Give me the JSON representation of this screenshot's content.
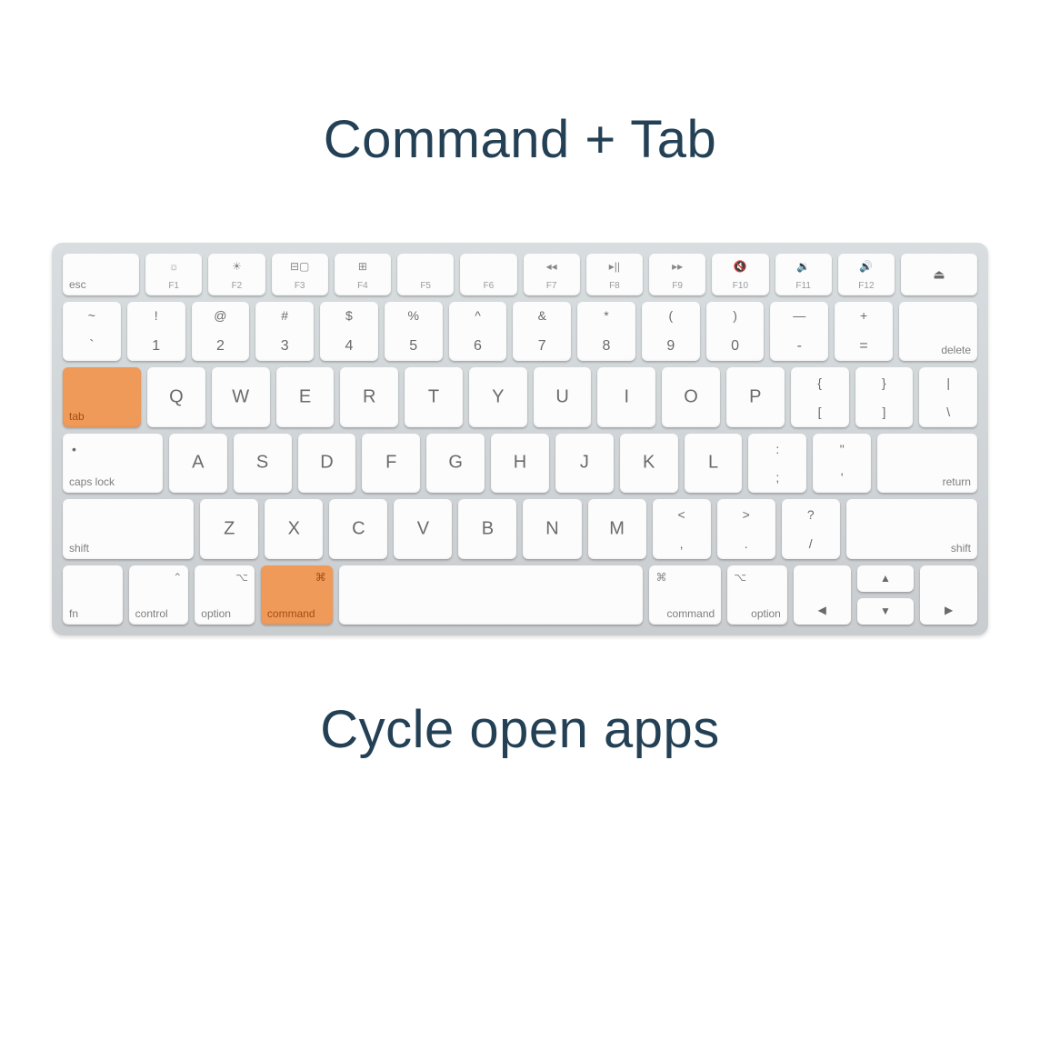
{
  "title": "Command + Tab",
  "subtitle": "Cycle open apps",
  "colors": {
    "highlight": "#f09a5a",
    "text": "#234055"
  },
  "rows": {
    "fn": {
      "esc": "esc",
      "keys": [
        {
          "icon": "☼",
          "label": "F1"
        },
        {
          "icon": "☀",
          "label": "F2"
        },
        {
          "icon": "⊟▢",
          "label": "F3"
        },
        {
          "icon": "⊞",
          "label": "F4"
        },
        {
          "icon": "",
          "label": "F5"
        },
        {
          "icon": "",
          "label": "F6"
        },
        {
          "icon": "◂◂",
          "label": "F7"
        },
        {
          "icon": "▸||",
          "label": "F8"
        },
        {
          "icon": "▸▸",
          "label": "F9"
        },
        {
          "icon": "🔇",
          "label": "F10"
        },
        {
          "icon": "🔉",
          "label": "F11"
        },
        {
          "icon": "🔊",
          "label": "F12"
        }
      ],
      "eject": "⏏"
    },
    "num": {
      "tilde": {
        "top": "~",
        "bot": "`"
      },
      "keys": [
        {
          "top": "!",
          "bot": "1"
        },
        {
          "top": "@",
          "bot": "2"
        },
        {
          "top": "#",
          "bot": "3"
        },
        {
          "top": "$",
          "bot": "4"
        },
        {
          "top": "%",
          "bot": "5"
        },
        {
          "top": "^",
          "bot": "6"
        },
        {
          "top": "&",
          "bot": "7"
        },
        {
          "top": "*",
          "bot": "8"
        },
        {
          "top": "(",
          "bot": "9"
        },
        {
          "top": ")",
          "bot": "0"
        },
        {
          "top": "—",
          "bot": "-"
        },
        {
          "top": "+",
          "bot": "="
        }
      ],
      "delete": "delete"
    },
    "qw": {
      "tab": "tab",
      "letters": [
        "Q",
        "W",
        "E",
        "R",
        "T",
        "Y",
        "U",
        "I",
        "O",
        "P"
      ],
      "br1": {
        "top": "{",
        "bot": "["
      },
      "br2": {
        "top": "}",
        "bot": "]"
      },
      "bs": {
        "top": "|",
        "bot": "\\"
      }
    },
    "as": {
      "caps": "caps lock",
      "letters": [
        "A",
        "S",
        "D",
        "F",
        "G",
        "H",
        "J",
        "K",
        "L"
      ],
      "sc": {
        "top": ":",
        "bot": ";"
      },
      "qt": {
        "top": "\"",
        "bot": "'"
      },
      "return": "return"
    },
    "zx": {
      "shiftL": "shift",
      "letters": [
        "Z",
        "X",
        "C",
        "V",
        "B",
        "N",
        "M"
      ],
      "cm": {
        "top": "<",
        "bot": ","
      },
      "pd": {
        "top": ">",
        "bot": "."
      },
      "sl": {
        "top": "?",
        "bot": "/"
      },
      "shiftR": "shift"
    },
    "bot": {
      "fn": "fn",
      "control": {
        "icon": "⌃",
        "label": "control"
      },
      "optionL": {
        "icon": "⌥",
        "label": "option"
      },
      "commandL": {
        "icon": "⌘",
        "label": "command"
      },
      "space": "",
      "commandR": {
        "icon": "⌘",
        "label": "command"
      },
      "optionR": {
        "icon": "⌥",
        "label": "option"
      },
      "arrows": {
        "left": "◀",
        "up": "▲",
        "down": "▼",
        "right": "▶"
      }
    }
  },
  "highlighted_keys": [
    "tab",
    "commandL"
  ]
}
